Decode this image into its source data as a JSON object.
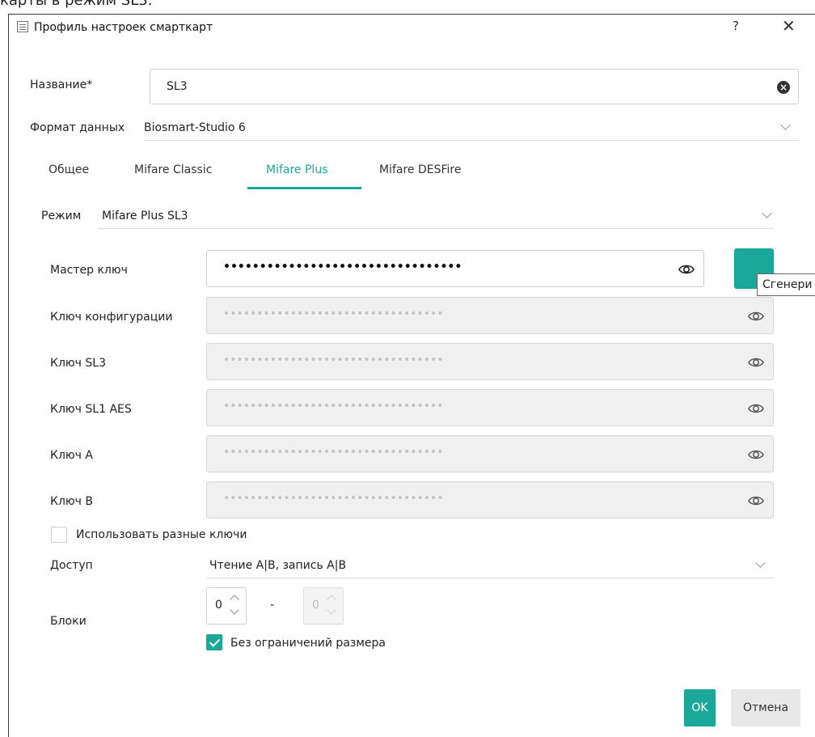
{
  "background": {
    "caption": "карты в режим SL3."
  },
  "dialog": {
    "title": "Профиль настроек смарткарт",
    "help_label": "?",
    "close_label": "✕"
  },
  "form": {
    "name_label": "Название*",
    "name_value": "SL3",
    "format_label": "Формат данных",
    "format_value": "Biosmart-Studio 6"
  },
  "tabs": [
    {
      "label": "Общее",
      "active": false
    },
    {
      "label": "Mifare Classic",
      "active": false
    },
    {
      "label": "Mifare Plus",
      "active": true
    },
    {
      "label": "Mifare DESFire",
      "active": false
    }
  ],
  "mode": {
    "label": "Режим",
    "value": "Mifare Plus SL3"
  },
  "keys": [
    {
      "label": "Мастер ключ",
      "value": "•••••••••••••••••••••••••••••••••",
      "enabled": true
    },
    {
      "label": "Ключ конфигурации",
      "value": "•••••••••••••••••••••••••••••••••",
      "enabled": false
    },
    {
      "label": "Ключ SL3",
      "value": "•••••••••••••••••••••••••••••••••",
      "enabled": false
    },
    {
      "label": "Ключ SL1 AES",
      "value": "•••••••••••••••••••••••••••••••••",
      "enabled": false
    },
    {
      "label": "Ключ A",
      "value": "•••••••••••••••••••••••••••••••••",
      "enabled": false
    },
    {
      "label": "Ключ B",
      "value": "•••••••••••••••••••••••••••••••••",
      "enabled": false
    }
  ],
  "generate": {
    "tooltip": "Сгенери"
  },
  "use_different_keys": {
    "label": "Использовать разные ключи",
    "checked": false
  },
  "access": {
    "label": "Доступ",
    "value": "Чтение A|B, запись A|B"
  },
  "blocks": {
    "label": "Блоки",
    "from": "0",
    "separator": "-",
    "to": "0",
    "unlimited_label": "Без ограничений размера",
    "unlimited_checked": true
  },
  "buttons": {
    "ok": "OK",
    "cancel": "Отмена"
  },
  "colors": {
    "accent": "#1aa89a",
    "disabled_field": "#f0f0f0"
  },
  "icons": [
    "list-icon",
    "clear-icon",
    "chevron-down-icon",
    "eye-icon",
    "generate-icon",
    "checkmark-icon"
  ]
}
